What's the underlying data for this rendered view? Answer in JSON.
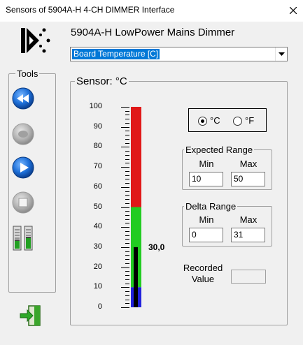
{
  "window": {
    "title": "Sensors of 5904A-H 4-CH DIMMER  Interface",
    "close_icon": "close-icon"
  },
  "header": {
    "logo_icon": "brand-logo-icon",
    "device_name": "5904A-H LowPower Mains Dimmer"
  },
  "sensor_select": {
    "selected": "Board Temperature [C]"
  },
  "tools": {
    "label": "Tools",
    "buttons": [
      {
        "name": "rewind-button",
        "icon": "rewind-icon",
        "enabled": true
      },
      {
        "name": "pause-button",
        "icon": "pause-icon",
        "enabled": false
      },
      {
        "name": "play-button",
        "icon": "play-icon",
        "enabled": true
      },
      {
        "name": "stop-button",
        "icon": "stop-icon",
        "enabled": false
      },
      {
        "name": "levels-button",
        "icon": "level-meters-icon",
        "enabled": true
      }
    ],
    "exit_icon": "exit-door-icon"
  },
  "sensor": {
    "legend": "Sensor: °C",
    "scale_labels": [
      "100",
      "90",
      "80",
      "70",
      "60",
      "50",
      "40",
      "30",
      "20",
      "10",
      "0"
    ],
    "scale_min": 0,
    "scale_max": 100,
    "value": 30.0,
    "value_text": "30,0",
    "zones": {
      "blue_max": 10,
      "green_max": 50,
      "red_max": 100
    },
    "colors": {
      "blue": "#2222dd",
      "green": "#22cc22",
      "red": "#e01818",
      "indicator": "#000000"
    }
  },
  "units": {
    "celsius": {
      "label": "°C",
      "checked": true
    },
    "fahrenheit": {
      "label": "°F",
      "checked": false
    }
  },
  "expected_range": {
    "legend": "Expected Range",
    "min_label": "Min",
    "max_label": "Max",
    "min": "10",
    "max": "50"
  },
  "delta_range": {
    "legend": "Delta Range",
    "min_label": "Min",
    "max_label": "Max",
    "min": "0",
    "max": "31"
  },
  "recorded": {
    "label": "Recorded Value",
    "value": ""
  }
}
